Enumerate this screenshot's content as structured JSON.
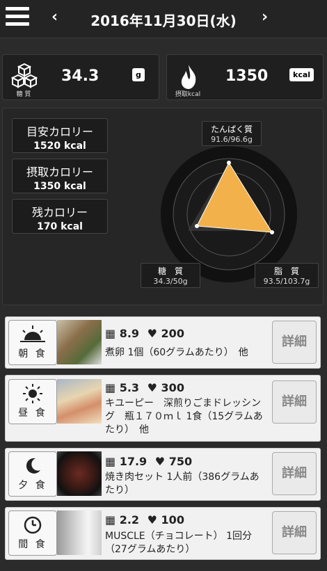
{
  "header": {
    "date": "2016年11月30日(水)",
    "prev_icon": "chevron-left-icon",
    "next_icon": "chevron-right-icon",
    "menu_icon": "hamburger-menu-icon"
  },
  "summary": {
    "carb_label": "糖 質",
    "carb_value": "34.3",
    "carb_unit": "g",
    "intake_label": "摂取kcal",
    "intake_value": "1350",
    "intake_unit": "kcal"
  },
  "calories": [
    {
      "label": "目安カロリー",
      "value": "1520 kcal"
    },
    {
      "label": "摂取カロリー",
      "value": "1350 kcal"
    },
    {
      "label": "残カロリー",
      "value": "170 kcal"
    }
  ],
  "radar": {
    "protein_label": "たんぱく質",
    "protein_value": "91.6/96.6g",
    "carb_label": "糖　質",
    "carb_value": "34.3/50g",
    "fat_label": "脂　質",
    "fat_value": "93.5/103.7g",
    "fill_color": "#f2b14a"
  },
  "meals": [
    {
      "name": "朝 食",
      "icon": "sunrise-icon",
      "carb": "8.9",
      "kcal": "200",
      "desc": "煮卵 1個（60グラムあたり）　他",
      "detail": "詳細"
    },
    {
      "name": "昼 食",
      "icon": "sun-icon",
      "carb": "5.3",
      "kcal": "300",
      "desc": "キユーピー　深煎りごまドレッシング　瓶１７０ｍｌ 1食（15グラムあたり）　他",
      "detail": "詳細"
    },
    {
      "name": "夕 食",
      "icon": "moon-icon",
      "carb": "17.9",
      "kcal": "750",
      "desc": "焼き肉セット 1人前（386グラムあたり）",
      "detail": "詳細"
    },
    {
      "name": "間 食",
      "icon": "clock-icon",
      "carb": "2.2",
      "kcal": "100",
      "desc": "MUSCLE（チョコレート） 1回分（27グラムあたり）",
      "detail": "詳細"
    }
  ]
}
